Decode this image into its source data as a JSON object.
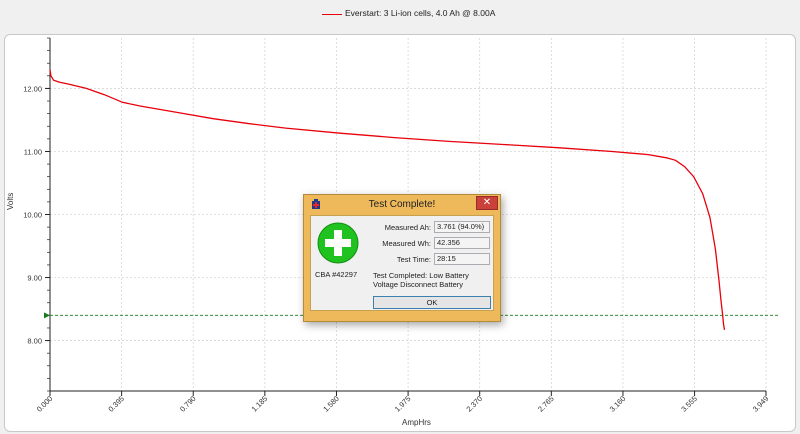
{
  "legend": {
    "label": "Everstart: 3 Li-ion cells, 4.0 Ah @ 8.00A",
    "color": "#e8000b"
  },
  "chart_data": {
    "type": "line",
    "xlabel": "AmpHrs",
    "ylabel": "Volts",
    "x_ticks": [
      "0.000",
      "0.395",
      "0.790",
      "1.185",
      "1.580",
      "1.975",
      "2.370",
      "2.765",
      "3.160",
      "3.555",
      "3.949"
    ],
    "y_ticks": [
      "8.00",
      "9.00",
      "10.00",
      "11.00",
      "12.00"
    ],
    "xlim": [
      0,
      3.949
    ],
    "ylim": [
      7.2,
      12.8
    ],
    "grid": true,
    "cutoff_voltage": 8.4,
    "series": [
      {
        "name": "Everstart: 3 Li-ion cells, 4.0 Ah @ 8.00A",
        "color": "#e8000b",
        "x": [
          0,
          0.005,
          0.02,
          0.05,
          0.1,
          0.2,
          0.3,
          0.4,
          0.5,
          0.7,
          0.9,
          1.1,
          1.3,
          1.6,
          1.9,
          2.2,
          2.5,
          2.8,
          3.1,
          3.3,
          3.4,
          3.45,
          3.5,
          3.55,
          3.6,
          3.64,
          3.67,
          3.69,
          3.7,
          3.71,
          3.715,
          3.72
        ],
        "y": [
          12.3,
          12.2,
          12.13,
          12.1,
          12.07,
          12.0,
          11.9,
          11.78,
          11.72,
          11.62,
          11.52,
          11.44,
          11.37,
          11.29,
          11.22,
          11.16,
          11.11,
          11.06,
          11.0,
          10.95,
          10.9,
          10.86,
          10.76,
          10.6,
          10.33,
          9.95,
          9.45,
          8.95,
          8.65,
          8.4,
          8.25,
          8.17
        ]
      }
    ]
  },
  "dialog": {
    "title": "Test Complete!",
    "close": "✕",
    "device": "CBA #42297",
    "fields": [
      {
        "label": "Measured Ah:",
        "value": "3.761 (94.0%)"
      },
      {
        "label": "Measured Wh:",
        "value": "42.356"
      },
      {
        "label": "Test Time:",
        "value": "28:15"
      }
    ],
    "message": "Test Completed: Low Battery Voltage Disconnect Battery",
    "ok": "OK"
  }
}
